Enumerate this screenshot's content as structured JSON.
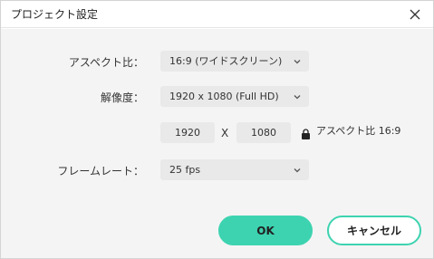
{
  "dialog": {
    "title": "プロジェクト設定",
    "close_icon": "close-icon"
  },
  "form": {
    "aspect_label": "アスペクト比：",
    "aspect_value": "16:9 (ワイドスクリーン)",
    "resolution_label": "解像度：",
    "resolution_value": "1920 x 1080 (Full HD)",
    "width_value": "1920",
    "separator": "X",
    "height_value": "1080",
    "lock_icon": "lock-icon",
    "aspect_note": "アスペクト比 16:9",
    "framerate_label": "フレームレート：",
    "framerate_value": "25 fps"
  },
  "buttons": {
    "ok_label": "OK",
    "cancel_label": "キャンセル"
  },
  "colors": {
    "accent": "#3dd3b0",
    "field_bg": "#e9e9e9",
    "body_bg": "#f4f4f4"
  }
}
